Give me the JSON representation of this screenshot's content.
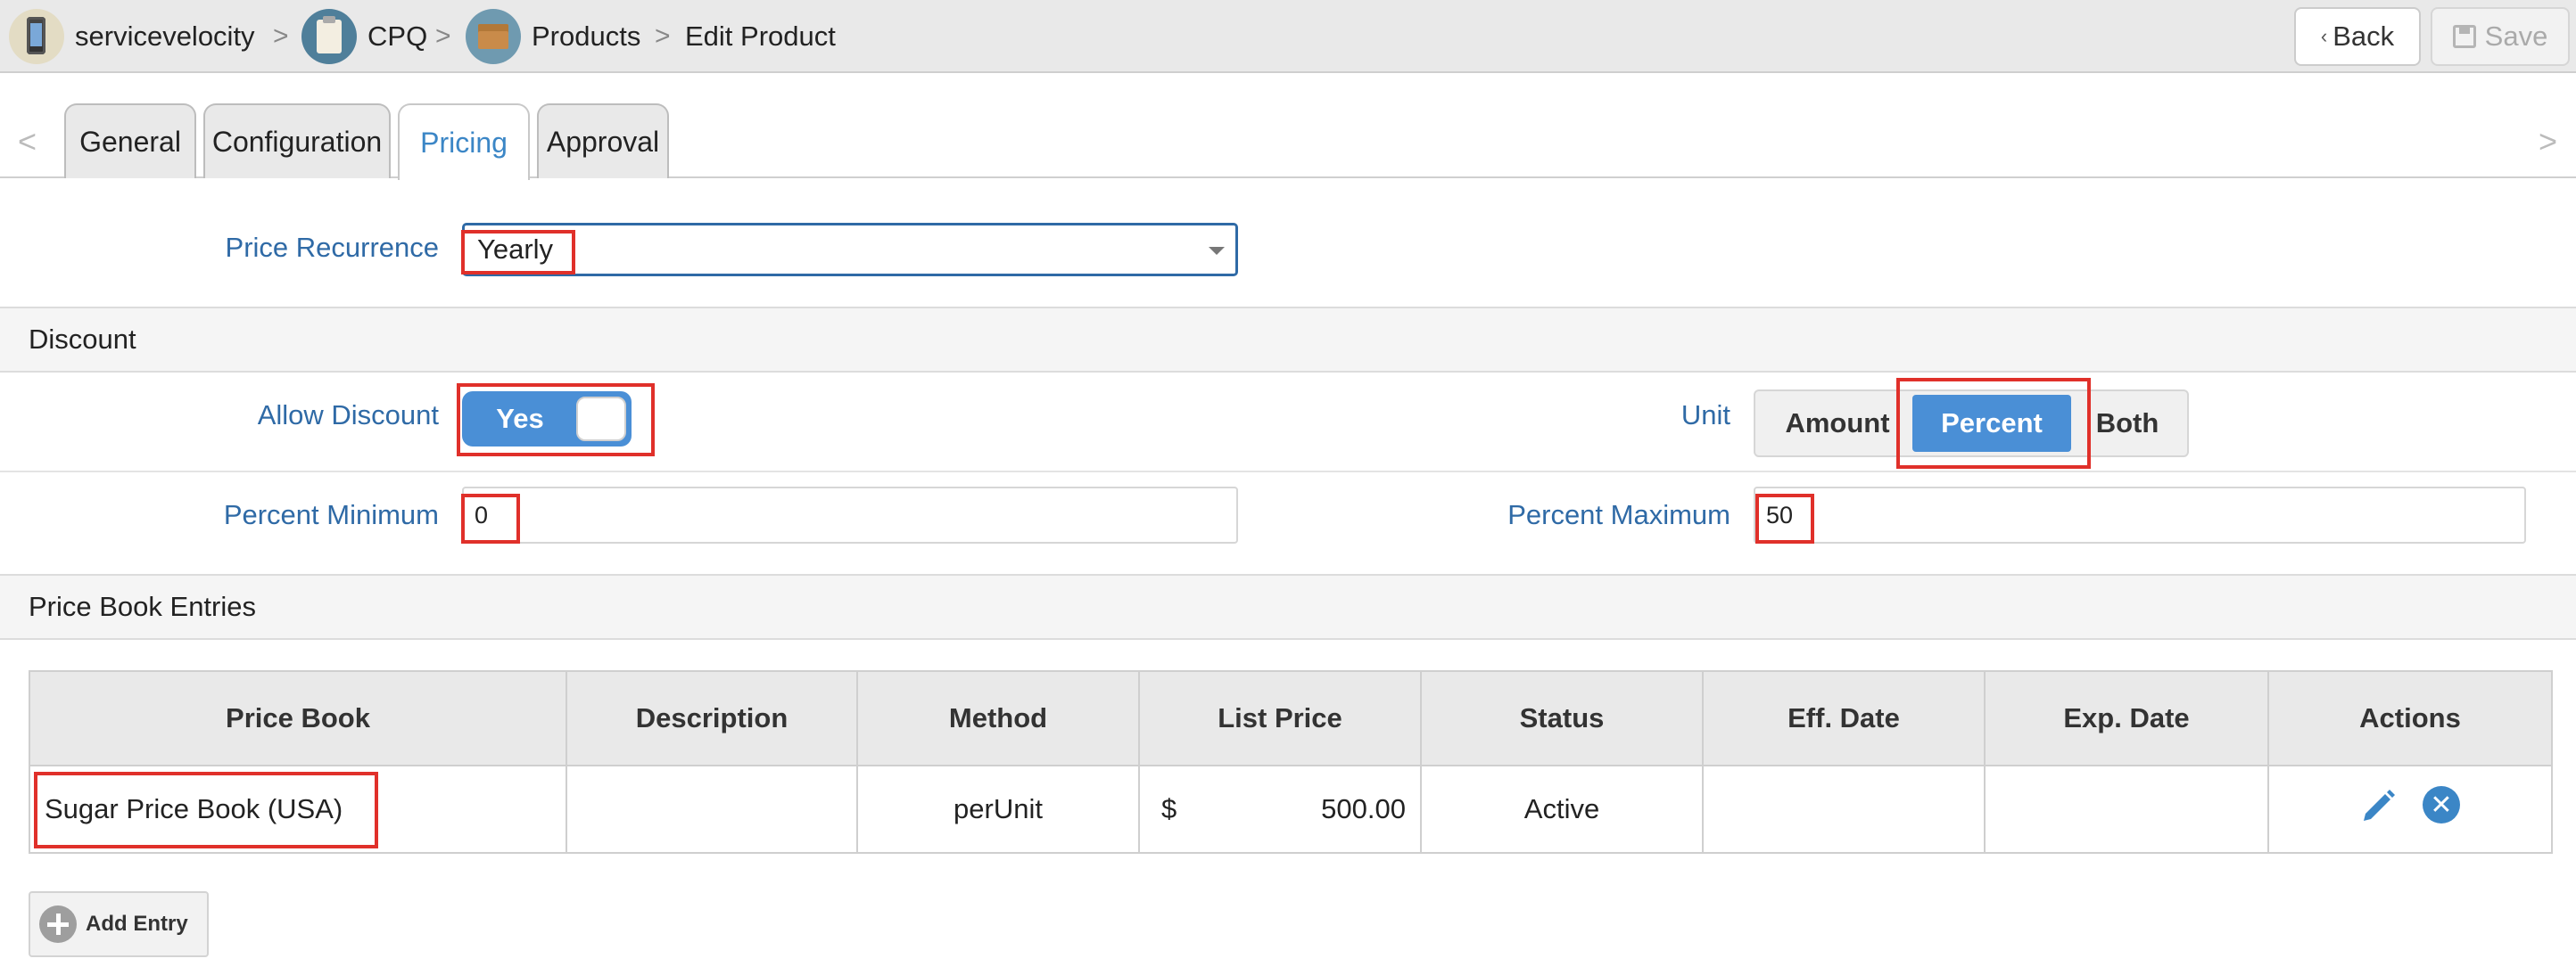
{
  "breadcrumb": {
    "items": [
      {
        "label": "servicevelocity",
        "icon": "phone-icon"
      },
      {
        "label": "CPQ",
        "icon": "clipboard-icon"
      },
      {
        "label": "Products",
        "icon": "box-icon"
      },
      {
        "label": "Edit Product"
      }
    ],
    "separator": ">"
  },
  "actions": {
    "back_label": "Back",
    "save_label": "Save"
  },
  "tabs": [
    {
      "label": "General"
    },
    {
      "label": "Configuration"
    },
    {
      "label": "Pricing",
      "active": true
    },
    {
      "label": "Approval"
    }
  ],
  "tab_nav": {
    "left": "<",
    "right": ">"
  },
  "pricing": {
    "price_recurrence_label": "Price Recurrence",
    "price_recurrence_value": "Yearly"
  },
  "discount": {
    "header": "Discount",
    "allow_discount_label": "Allow Discount",
    "allow_discount_value": "Yes",
    "unit_label": "Unit",
    "unit_options": [
      "Amount",
      "Percent",
      "Both"
    ],
    "unit_selected": "Percent",
    "percent_min_label": "Percent Minimum",
    "percent_min_value": "0",
    "percent_max_label": "Percent Maximum",
    "percent_max_value": "50"
  },
  "price_book": {
    "header": "Price Book Entries",
    "columns": [
      "Price Book",
      "Description",
      "Method",
      "List Price",
      "Status",
      "Eff. Date",
      "Exp. Date",
      "Actions"
    ],
    "rows": [
      {
        "price_book": "Sugar Price Book (USA)",
        "description": "",
        "method": "perUnit",
        "currency": "$",
        "list_price": "500.00",
        "status": "Active",
        "eff_date": "",
        "exp_date": ""
      }
    ],
    "add_label": "Add Entry"
  },
  "colors": {
    "accent": "#4a8fd6",
    "label": "#2f6aa6",
    "highlight": "#e0302a"
  }
}
